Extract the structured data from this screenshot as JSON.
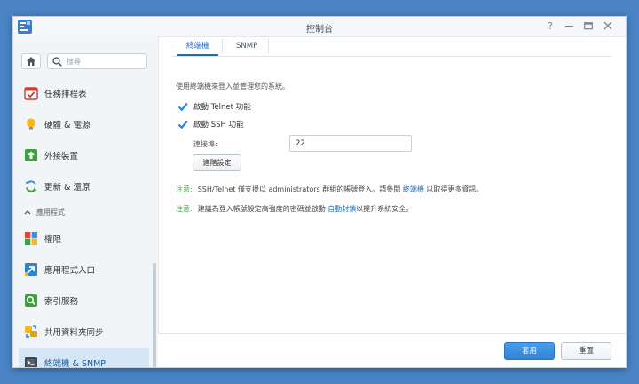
{
  "window": {
    "title": "控制台"
  },
  "sidebar": {
    "search": {
      "placeholder": "搜尋"
    },
    "items": [
      {
        "label": "任務排程表",
        "icon": "calendar-check-icon"
      },
      {
        "label": "硬體 & 電源",
        "icon": "lightbulb-icon"
      },
      {
        "label": "外接裝置",
        "icon": "upload-arrow-icon"
      },
      {
        "label": "更新 & 還原",
        "icon": "refresh-icon"
      }
    ],
    "section_header": "應用程式",
    "app_items": [
      {
        "label": "權限",
        "icon": "grid-squares-icon"
      },
      {
        "label": "應用程式入口",
        "icon": "portal-arrow-icon"
      },
      {
        "label": "索引服務",
        "icon": "magnifier-icon"
      },
      {
        "label": "共用資料夾同步",
        "icon": "folder-sync-icon"
      },
      {
        "label": "終端機 & SNMP",
        "icon": "terminal-icon",
        "active": true
      }
    ]
  },
  "tabs": [
    {
      "label": "終端機",
      "active": true
    },
    {
      "label": "SNMP",
      "active": false
    }
  ],
  "content": {
    "description": "使用終端機來登入並管理您的系統。",
    "telnet_label": "啟動 Telnet 功能",
    "telnet_checked": true,
    "ssh_label": "啟動 SSH 功能",
    "ssh_checked": true,
    "port_label": "連接埠:",
    "port_value": "22",
    "advanced_button": "進階設定",
    "note1": {
      "tag": "注意:",
      "text_before": "SSH/Telnet 僅支援以 administrators 群組的帳號登入。請參閱",
      "link": "終端機",
      "text_after": "以取得更多資訊。"
    },
    "note2": {
      "tag": "注意:",
      "text_before": "建議為登入帳號設定高強度的密碼並啟動",
      "link": "自動封鎖",
      "text_after": "以提升系統安全。"
    }
  },
  "footer": {
    "apply_label": "套用",
    "reset_label": "重置"
  },
  "colors": {
    "accent": "#1c6bbf",
    "active_bg": "#d5e6f7",
    "note_green": "#3aa53a",
    "desktop": "#4a84c4"
  }
}
